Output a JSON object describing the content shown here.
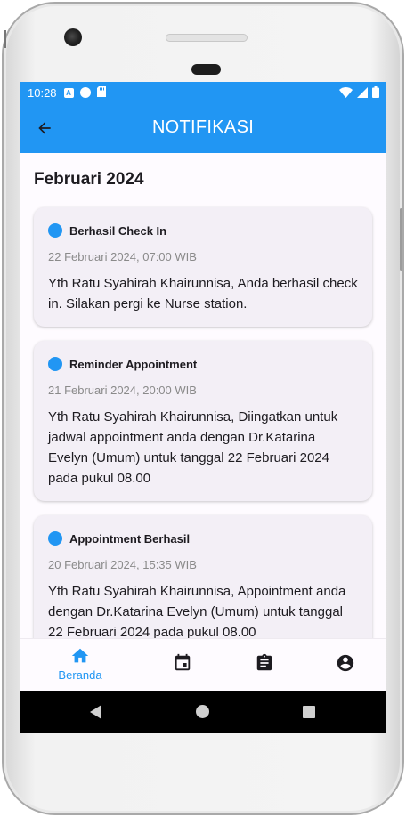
{
  "status_bar": {
    "time": "10:28",
    "notif_icons": [
      "a-icon",
      "g-circle-icon",
      "sd-card-icon"
    ],
    "system_icons": [
      "wifi-icon",
      "signal-icon",
      "battery-icon"
    ]
  },
  "app_bar": {
    "title": "NOTIFIKASI",
    "back_icon": "arrow-left-icon"
  },
  "colors": {
    "primary": "#2196f3",
    "card_bg": "#f3eff6",
    "text": "#1d1b20",
    "muted": "#8a8a8a"
  },
  "month_heading": "Februari 2024",
  "notifications": [
    {
      "title": "Berhasil Check In",
      "time": "22 Februari 2024, 07:00 WIB",
      "body": "Yth Ratu Syahirah Khairunnisa, Anda berhasil check in. Silakan pergi ke Nurse station."
    },
    {
      "title": "Reminder Appointment",
      "time": "21 Februari 2024, 20:00 WIB",
      "body": "Yth Ratu Syahirah Khairunnisa, Diingatkan untuk jadwal appointment anda dengan Dr.Katarina Evelyn (Umum) untuk tanggal 22 Februari 2024 pada pukul 08.00"
    },
    {
      "title": "Appointment Berhasil",
      "time": "20 Februari 2024, 15:35 WIB",
      "body": "Yth Ratu Syahirah Khairunnisa, Appointment anda dengan Dr.Katarina Evelyn (Umum) untuk tanggal 22 Februari 2024 pada pukul 08.00"
    }
  ],
  "bottom_nav": {
    "items": [
      {
        "icon": "home-icon",
        "label": "Beranda",
        "active": true
      },
      {
        "icon": "calendar-icon",
        "label": "",
        "active": false
      },
      {
        "icon": "clipboard-icon",
        "label": "",
        "active": false
      },
      {
        "icon": "account-icon",
        "label": "",
        "active": false
      }
    ]
  },
  "system_nav": [
    "back-triangle-icon",
    "home-circle-icon",
    "recents-square-icon"
  ]
}
